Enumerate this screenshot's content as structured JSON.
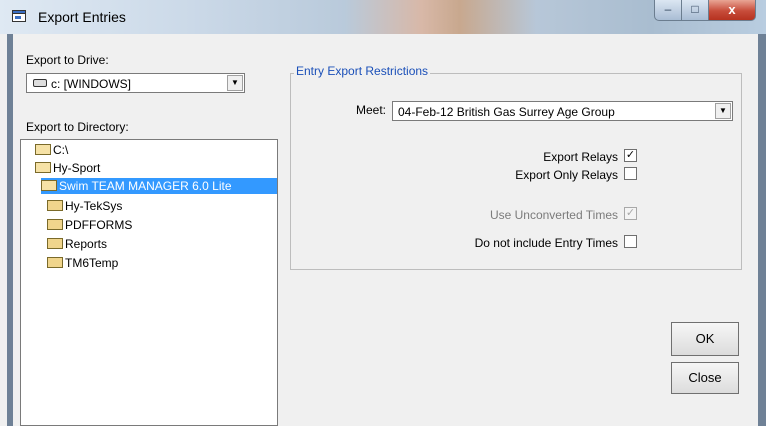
{
  "window": {
    "title": "Export Entries",
    "minimize": "–",
    "maximize": "□",
    "close": "x"
  },
  "drive": {
    "label": "Export to Drive:",
    "value": "c: [WINDOWS]"
  },
  "directory": {
    "label": "Export to Directory:",
    "items": [
      {
        "name": "C:\\",
        "open": true
      },
      {
        "name": "Hy-Sport",
        "open": true
      },
      {
        "name": "Swim TEAM MANAGER 6.0 Lite",
        "open": true,
        "selected": true
      },
      {
        "name": "Hy-TekSys",
        "open": false
      },
      {
        "name": "PDFFORMS",
        "open": false
      },
      {
        "name": "Reports",
        "open": false
      },
      {
        "name": "TM6Temp",
        "open": false
      }
    ]
  },
  "restrictions": {
    "group_title": "Entry Export Restrictions",
    "meet_label": "Meet:",
    "meet_value": "04-Feb-12 British Gas Surrey Age Group",
    "export_relays": {
      "label": "Export Relays",
      "checked": true,
      "enabled": true
    },
    "export_only_relays": {
      "label": "Export Only Relays",
      "checked": false,
      "enabled": true
    },
    "use_unconverted": {
      "label": "Use Unconverted Times",
      "checked": true,
      "enabled": false
    },
    "no_entry_times": {
      "label": "Do not include Entry Times",
      "checked": false,
      "enabled": true
    }
  },
  "buttons": {
    "ok": "OK",
    "close": "Close"
  },
  "colors": {
    "selection": "#3399ff",
    "group_title": "#1a4fb8"
  }
}
